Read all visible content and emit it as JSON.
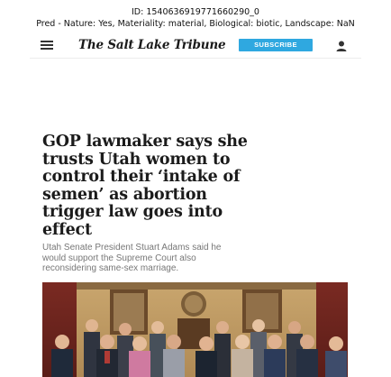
{
  "caption": {
    "line1": "ID: 1540636919771660290_0",
    "line2": "Pred - Nature: Yes, Materiality: material, Biological: biotic, Landscape: NaN"
  },
  "header": {
    "menu_icon": "hamburger-menu-icon",
    "masthead": "The Salt Lake Tribune",
    "subscribe_label": "SUBSCRIBE",
    "account_icon": "user-icon"
  },
  "article": {
    "headline_lines": [
      "GOP lawmaker says she",
      "trusts Utah women to",
      "control their ‘intake of",
      "semen’ as abortion",
      "trigger law goes into",
      "effect"
    ],
    "subhead_lines": [
      "Utah Senate President Stuart Adams said he",
      "would support the Supreme Court also",
      "reconsidering same-sex marriage."
    ]
  }
}
